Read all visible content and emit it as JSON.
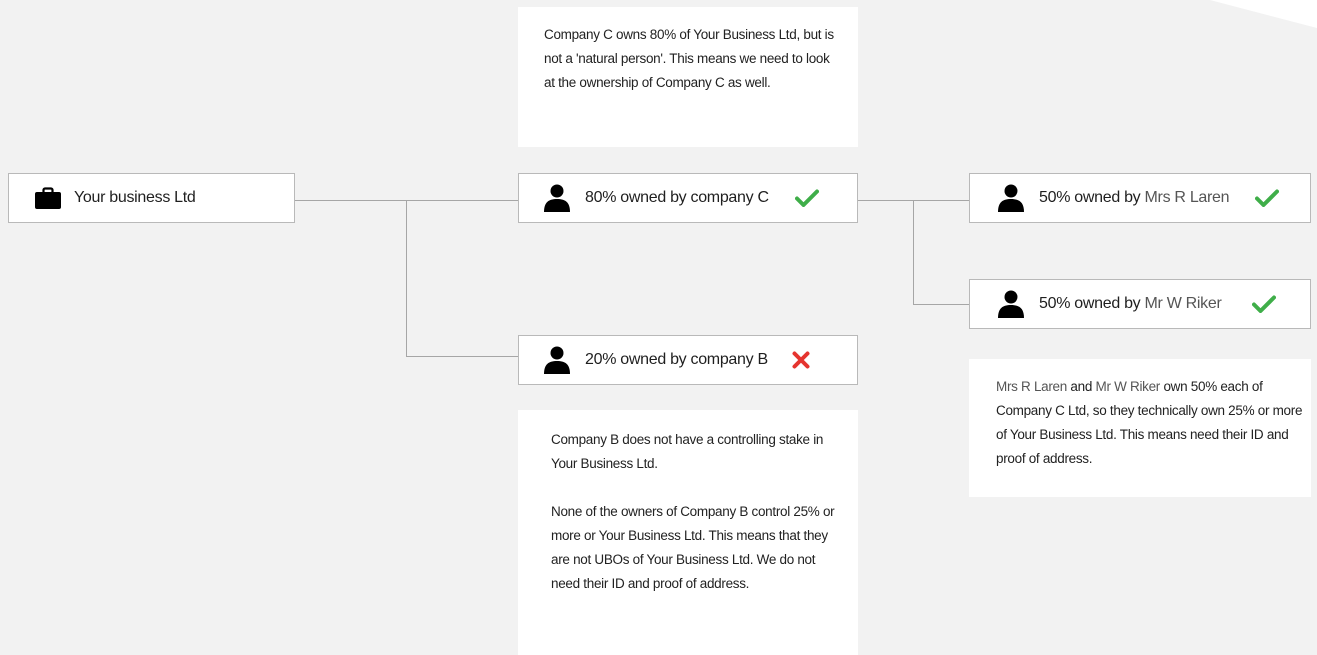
{
  "colors": {
    "background": "#f2f2f2",
    "card": "#ffffff",
    "border": "#b9b9b9",
    "connector": "#a6a6a6",
    "check": "#3fae49",
    "cross": "#e5342f",
    "name_text": "#555555"
  },
  "root": {
    "label": "Your business Ltd",
    "icon": "briefcase-icon"
  },
  "owners": [
    {
      "label": "80% owned by company C",
      "icon": "person-icon",
      "status": "check-icon"
    },
    {
      "label": "20% owned by company B",
      "icon": "person-icon",
      "status": "cross-icon"
    }
  ],
  "sub_owners": [
    {
      "prefix": "50% owned by ",
      "name": "Mrs R Laren",
      "icon": "person-icon",
      "status": "check-icon"
    },
    {
      "prefix": "50% owned by ",
      "name": "Mr W Riker",
      "icon": "person-icon",
      "status": "check-icon"
    }
  ],
  "notes": {
    "company_c": "Company C owns 80% of Your Business Ltd, but is not a 'natural person'. This means we need to look at the ownership of Company C as well.",
    "company_b_p1": "Company B does not have a controlling stake in Your Business Ltd.",
    "company_b_p2": "None of the owners of Company B control 25% or more or Your Business Ltd. This means that they are not UBOs of Your Business Ltd. We do not need their ID and proof of address.",
    "ubo": {
      "name1": "Mrs R Laren",
      "and": " and ",
      "name2": "Mr W Riker",
      "rest": " own 50% each of Company C Ltd, so they technically own 25% or more of Your Business Ltd.  This means need their ID and proof of address."
    }
  }
}
